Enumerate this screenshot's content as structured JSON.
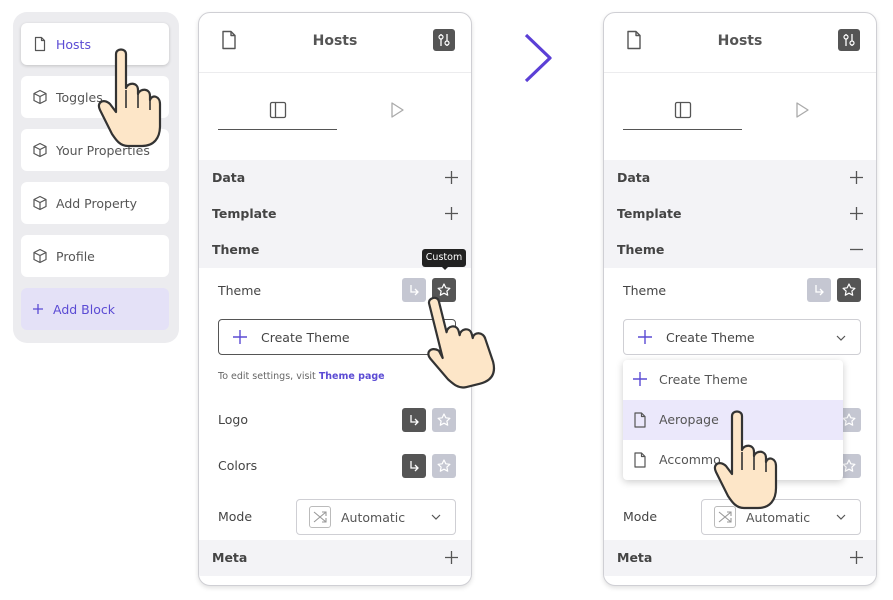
{
  "sidebar": {
    "items": [
      {
        "label": "Hosts",
        "icon": "document-icon"
      },
      {
        "label": "Toggles",
        "icon": "cube-icon"
      },
      {
        "label": "Your Properties",
        "icon": "cube-icon"
      },
      {
        "label": "Add Property",
        "icon": "cube-icon"
      },
      {
        "label": "Profile",
        "icon": "cube-icon"
      }
    ],
    "add_block": "Add Block"
  },
  "panel_before": {
    "title": "Hosts",
    "sections": {
      "data": "Data",
      "template": "Template",
      "theme": "Theme",
      "meta": "Meta"
    },
    "theme_label": "Theme",
    "tooltip": "Custom",
    "create_theme": "Create Theme",
    "hint_prefix": "To edit settings, visit",
    "hint_link": "Theme page",
    "logo_label": "Logo",
    "colors_label": "Colors",
    "mode_label": "Mode",
    "mode_value": "Automatic"
  },
  "panel_after": {
    "title": "Hosts",
    "sections": {
      "data": "Data",
      "template": "Template",
      "theme": "Theme",
      "meta": "Meta"
    },
    "theme_label": "Theme",
    "create_theme": "Create Theme",
    "mode_label": "Mode",
    "mode_value": "Automatic",
    "dropdown": {
      "items": [
        "Create Theme",
        "Aeropage",
        "Accommo"
      ]
    }
  },
  "colors": {
    "accent": "#5b4bd4",
    "dark_button": "#555555",
    "light_button": "#c5c7d2",
    "section_bg": "#f3f3f6"
  }
}
